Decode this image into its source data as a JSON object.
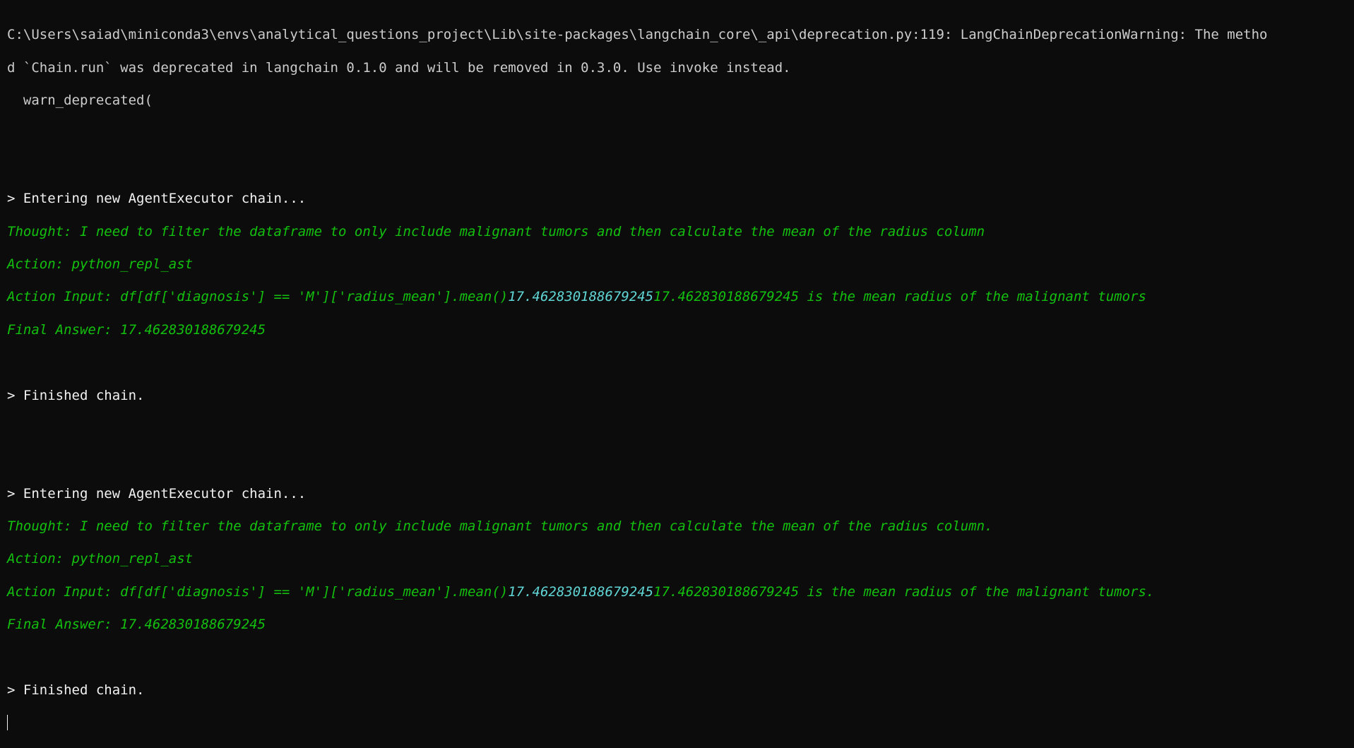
{
  "warning": {
    "line1": "C:\\Users\\saiad\\miniconda3\\envs\\analytical_questions_project\\Lib\\site-packages\\langchain_core\\_api\\deprecation.py:119: LangChainDeprecationWarning: The metho",
    "line2": "d `Chain.run` was deprecated in langchain 0.1.0 and will be removed in 0.3.0. Use invoke instead.",
    "line3": "  warn_deprecated("
  },
  "run1": {
    "entering": "> Entering new AgentExecutor chain...",
    "thought": "Thought: I need to filter the dataframe to only include malignant tumors and then calculate the mean of the radius column",
    "action": "Action: python_repl_ast",
    "action_input": "Action Input: df[df['diagnosis'] == 'M']['radius_mean'].mean()",
    "observation": "17.462830188679245",
    "followup": "17.462830188679245 is the mean radius of the malignant tumors",
    "final_answer": "Final Answer: 17.462830188679245",
    "finished": "> Finished chain."
  },
  "run2": {
    "entering": "> Entering new AgentExecutor chain...",
    "thought": "Thought: I need to filter the dataframe to only include malignant tumors and then calculate the mean of the radius column.",
    "action": "Action: python_repl_ast",
    "action_input": "Action Input: df[df['diagnosis'] == 'M']['radius_mean'].mean()",
    "observation": "17.462830188679245",
    "followup": "17.462830188679245 is the mean radius of the malignant tumors.",
    "final_answer": "Final Answer: 17.462830188679245",
    "finished": "> Finished chain."
  },
  "colors": {
    "background": "#0c0c0c",
    "default_text": "#cccccc",
    "highlight_text": "#f2f2f2",
    "agent_text": "#13c10e",
    "observation_text": "#61d6d6"
  }
}
